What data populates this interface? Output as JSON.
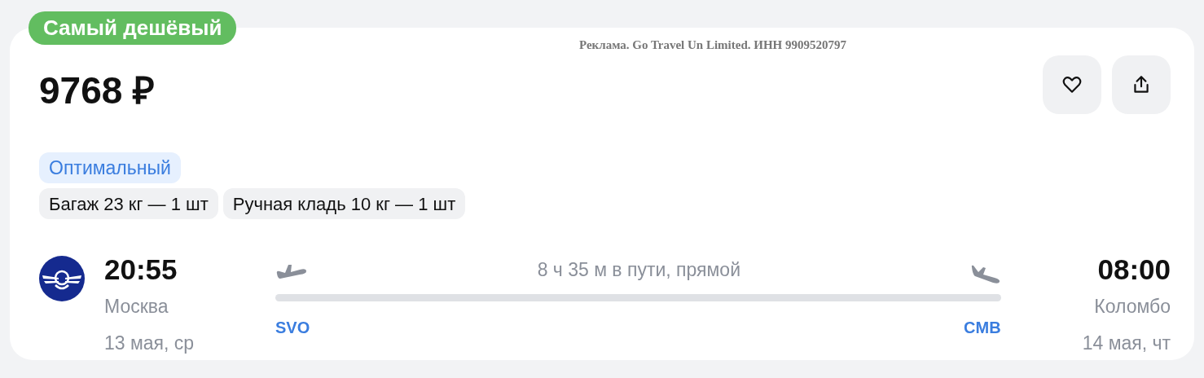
{
  "badge": "Самый дешёвый",
  "ad_label": "Реклама. Go Travel Un Limited. ИНН 9909520797",
  "price": "9768 ₽",
  "actions": [
    {
      "kind": "favorite"
    },
    {
      "kind": "share"
    }
  ],
  "fare": "Оптимальный",
  "baggage": [
    "Багаж 23 кг — 1 шт",
    "Ручная кладь 10 кг — 1 шт"
  ],
  "flight": {
    "departure": {
      "time": "20:55",
      "city": "Москва",
      "date": "13 мая, ср",
      "airport": "SVO"
    },
    "duration": "8 ч 35 м в пути, прямой",
    "arrival": {
      "time": "08:00",
      "city": "Коломбо",
      "date": "14 мая, чт",
      "airport": "CMB"
    }
  }
}
